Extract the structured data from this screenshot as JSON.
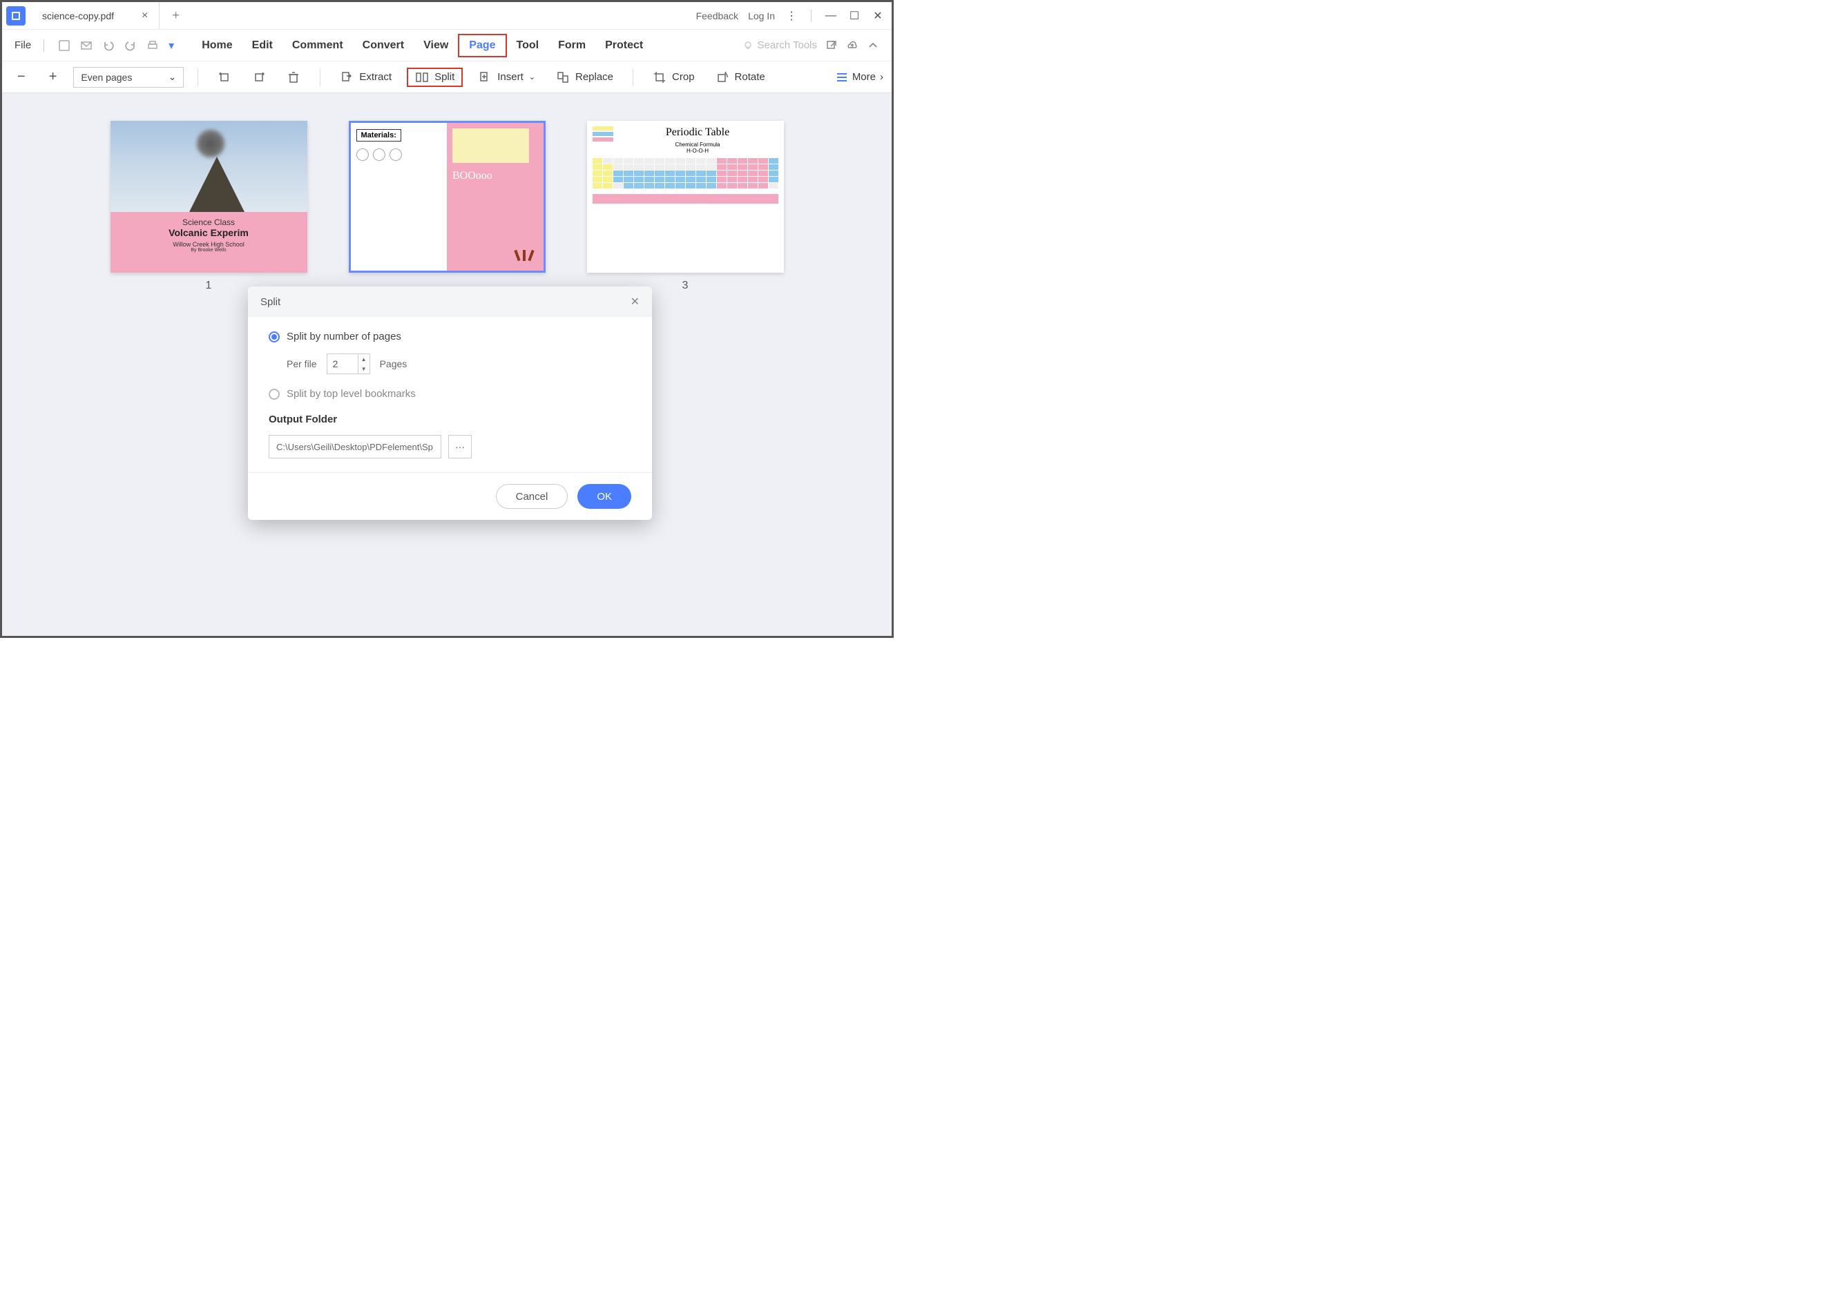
{
  "titlebar": {
    "tab_title": "science-copy.pdf",
    "feedback": "Feedback",
    "login": "Log In"
  },
  "menubar": {
    "file": "File",
    "items": [
      "Home",
      "Edit",
      "Comment",
      "Convert",
      "View",
      "Page",
      "Tool",
      "Form",
      "Protect"
    ],
    "active_index": 5,
    "search_placeholder": "Search Tools"
  },
  "toolbar": {
    "page_select": "Even pages",
    "extract": "Extract",
    "split": "Split",
    "insert": "Insert",
    "replace": "Replace",
    "crop": "Crop",
    "rotate": "Rotate",
    "more": "More"
  },
  "pages": {
    "p1": {
      "num": "1",
      "line1": "Science Class",
      "line2": "Volcanic Experim",
      "line3": "Willow Creek High School",
      "line4": "By Brooke Wells"
    },
    "p2": {
      "materials": "Materials:",
      "boo": "BOOooo"
    },
    "p3": {
      "num": "3",
      "title": "Periodic Table",
      "sub1": "Chemical Formula",
      "sub2": "H-O-O-H"
    }
  },
  "dialog": {
    "title": "Split",
    "opt1": "Split by number of pages",
    "per_file": "Per file",
    "per_file_value": "2",
    "pages_suffix": "Pages",
    "opt2": "Split by top level bookmarks",
    "output_folder_label": "Output Folder",
    "output_folder_value": "C:\\Users\\Geili\\Desktop\\PDFelement\\Sp",
    "cancel": "Cancel",
    "ok": "OK"
  }
}
